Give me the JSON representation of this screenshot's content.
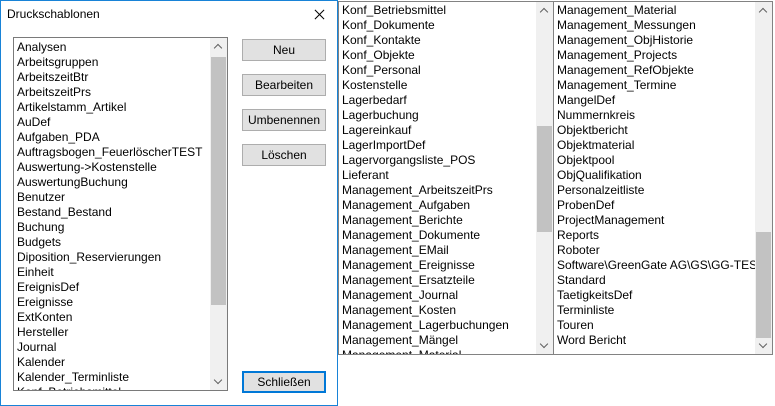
{
  "dialog": {
    "title": "Druckschablonen",
    "list_items": [
      "Analysen",
      "Arbeitsgruppen",
      "ArbeitszeitBtr",
      "ArbeitszeitPrs",
      "Artikelstamm_Artikel",
      "AuDef",
      "Aufgaben_PDA",
      "Auftragsbogen_FeuerlöscherTEST",
      "Auswertung->Kostenstelle",
      "AuswertungBuchung",
      "Benutzer",
      "Bestand_Bestand",
      "Buchung",
      "Budgets",
      "Diposition_Reservierungen",
      "Einheit",
      "EreignisDef",
      "Ereignisse",
      "ExtKonten",
      "Hersteller",
      "Journal",
      "Kalender",
      "Kalender_Terminliste",
      "Konf_Betriebsmittel"
    ],
    "buttons": {
      "new": "Neu",
      "edit": "Bearbeiten",
      "rename": "Umbenennen",
      "delete": "Löschen",
      "close": "Schließen"
    }
  },
  "middle_list": [
    "Konf_Betriebsmittel",
    "Konf_Dokumente",
    "Konf_Kontakte",
    "Konf_Objekte",
    "Konf_Personal",
    "Kostenstelle",
    "Lagerbedarf",
    "Lagerbuchung",
    "Lagereinkauf",
    "LagerImportDef",
    "Lagervorgangsliste_POS",
    "Lieferant",
    "Management_ArbeitszeitPrs",
    "Management_Aufgaben",
    "Management_Berichte",
    "Management_Dokumente",
    "Management_EMail",
    "Management_Ereignisse",
    "Management_Ersatzteile",
    "Management_Journal",
    "Management_Kosten",
    "Management_Lagerbuchungen",
    "Management_Mängel",
    "Management_Material"
  ],
  "right_list": [
    "Management_Material",
    "Management_Messungen",
    "Management_ObjHistorie",
    "Management_Projects",
    "Management_RefObjekte",
    "Management_Termine",
    "MangelDef",
    "Nummernkreis",
    "Objektbericht",
    "Objektmaterial",
    "Objektpool",
    "ObjQualifikation",
    "Personalzeitliste",
    "ProbenDef",
    "ProjectManagement",
    "Reports",
    "Roboter",
    "Software\\GreenGate AG\\GS\\GG-TEST",
    "Standard",
    "TaetigkeitsDef",
    "Terminliste",
    "Touren",
    "Word Bericht"
  ],
  "scroll_positions": {
    "dialog": 0.0,
    "middle": 0.38,
    "right": 1.0
  }
}
